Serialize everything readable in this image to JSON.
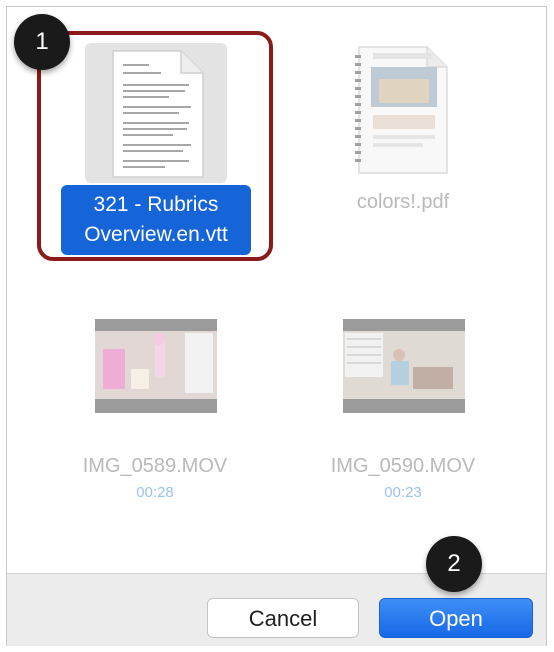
{
  "files": [
    {
      "name_line1": "321 - Rubrics",
      "name_line2": "Overview.en.vtt",
      "type": "vtt",
      "selected": true
    },
    {
      "name": "colors!.pdf",
      "type": "pdf",
      "selected": false
    },
    {
      "name": "IMG_0589.MOV",
      "duration": "00:28",
      "type": "mov",
      "selected": false
    },
    {
      "name": "IMG_0590.MOV",
      "duration": "00:23",
      "type": "mov",
      "selected": false
    }
  ],
  "buttons": {
    "cancel": "Cancel",
    "open": "Open"
  },
  "callouts": {
    "step1": "1",
    "step2": "2"
  },
  "colors": {
    "selection": "#1565d8",
    "callout": "#1a1a1a",
    "highlight_border": "#8b1a1a",
    "primary_button": "#1769e6"
  }
}
